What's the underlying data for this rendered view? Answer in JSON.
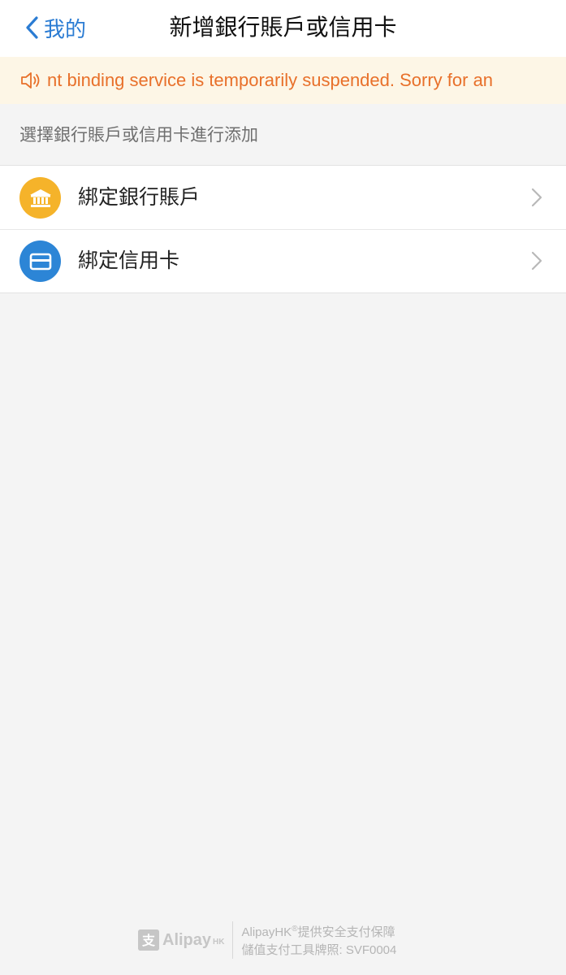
{
  "nav": {
    "back_label": "我的",
    "title": "新增銀行賬戶或信用卡"
  },
  "notice": {
    "icon": "speaker-icon",
    "text": "nt binding service is temporarily suspended. Sorry for an",
    "color": "#e8702a"
  },
  "section": {
    "hint": "選擇銀行賬戶或信用卡進行添加"
  },
  "options": [
    {
      "label": "綁定銀行賬戶",
      "icon": "bank-icon",
      "color": "#f5b32a"
    },
    {
      "label": "綁定信用卡",
      "icon": "credit-card-icon",
      "color": "#2c85d6"
    }
  ],
  "footer": {
    "logo_name": "Alipay",
    "logo_suffix": "HK",
    "line1_brand": "AlipayHK",
    "line1_reg": "®",
    "line1_rest": "提供安全支付保障",
    "line2": "儲值支付工具牌照: SVF0004"
  }
}
